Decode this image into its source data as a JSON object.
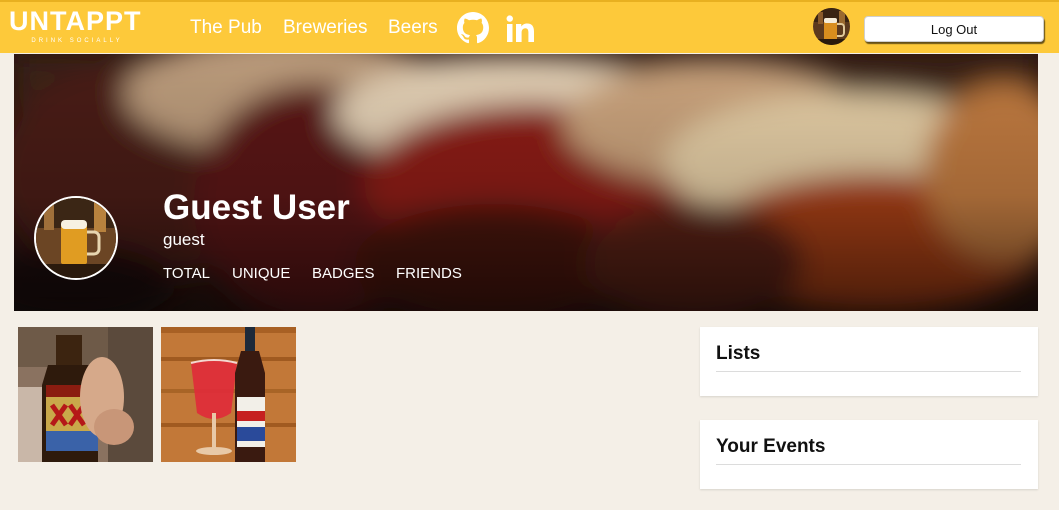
{
  "nav": {
    "logo_text": "UNTAPPT",
    "logo_tagline": "DRINK SOCIALLY",
    "links": [
      "The Pub",
      "Breweries",
      "Beers"
    ],
    "icons": [
      "github-icon",
      "linkedin-icon"
    ],
    "logout_label": "Log Out",
    "colors": {
      "bar": "#fdc93a",
      "text": "#ffffff"
    }
  },
  "profile": {
    "name": "Guest User",
    "username": "guest",
    "stats": [
      "TOTAL",
      "UNIQUE",
      "BADGES",
      "FRIENDS"
    ]
  },
  "photos": [
    "dos-equis-amber-photo",
    "red-beer-bottle-glass-photo"
  ],
  "panels": {
    "lists_title": "Lists",
    "events_title": "Your Events"
  },
  "colors": {
    "page_bg": "#f4efe7",
    "panel_bg": "#ffffff"
  }
}
